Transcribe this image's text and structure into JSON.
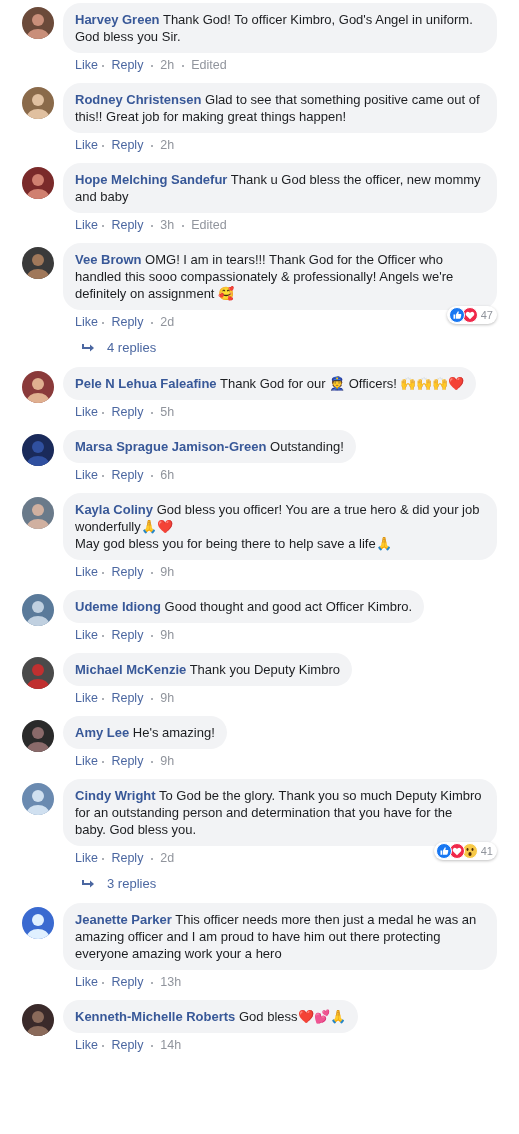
{
  "comments": [
    {
      "author": "Harvey Green",
      "text": "Thank God! To officer Kimbro, God's Angel in uniform. God bless you Sir.",
      "actions": [
        "Like",
        "Reply"
      ],
      "time": "2h",
      "edited": "Edited"
    },
    {
      "author": "Rodney Christensen",
      "text": "Glad to see that something positive came out of this!! Great job for making great things happen!",
      "actions": [
        "Like",
        "Reply"
      ],
      "time": "2h"
    },
    {
      "author": "Hope Melching Sandefur",
      "text": "Thank u God bless the officer, new mommy and baby",
      "actions": [
        "Like",
        "Reply"
      ],
      "time": "3h",
      "edited": "Edited"
    },
    {
      "author": "Vee Brown",
      "text": "OMG! I am in tears!!! Thank God for the Officer who handled this sooo compassionately & professionally! Angels we're definitely on assignment 🥰",
      "actions": [
        "Like",
        "Reply"
      ],
      "time": "2d",
      "reactions": {
        "icons": [
          {
            "kind": "like"
          },
          {
            "kind": "love"
          }
        ],
        "count": "47"
      },
      "replies": "4 replies"
    },
    {
      "author": "Pele N Lehua Faleafine",
      "text": "Thank God for our 👮 Officers! 🙌🙌🙌❤️",
      "actions": [
        "Like",
        "Reply"
      ],
      "time": "5h"
    },
    {
      "author": "Marsa Sprague Jamison-Green",
      "text": "Outstanding!",
      "actions": [
        "Like",
        "Reply"
      ],
      "time": "6h"
    },
    {
      "author": "Kayla Coliny",
      "text": "God bless you officer! You are a true hero & did your job wonderfully🙏❤️\nMay god bless you for being there to help save a life🙏",
      "actions": [
        "Like",
        "Reply"
      ],
      "time": "9h"
    },
    {
      "author": "Udeme Idiong",
      "text": "Good thought and good act Officer Kimbro.",
      "actions": [
        "Like",
        "Reply"
      ],
      "time": "9h"
    },
    {
      "author": "Michael McKenzie",
      "text": "Thank you Deputy Kimbro",
      "actions": [
        "Like",
        "Reply"
      ],
      "time": "9h"
    },
    {
      "author": "Amy Lee",
      "text": "He's amazing!",
      "actions": [
        "Like",
        "Reply"
      ],
      "time": "9h"
    },
    {
      "author": "Cindy Wright",
      "text": "To God be the glory. Thank you so much Deputy Kimbro for an outstanding person and determination that you have for the baby. God bless you.",
      "actions": [
        "Like",
        "Reply"
      ],
      "time": "2d",
      "reactions": {
        "icons": [
          {
            "kind": "like"
          },
          {
            "kind": "love"
          },
          {
            "kind": "wow"
          }
        ],
        "count": "41"
      },
      "replies": "3 replies"
    },
    {
      "author": "Jeanette Parker",
      "text": "This officer needs more then just a medal he was an amazing officer and I am proud to have him out there protecting everyone amazing work your a hero",
      "actions": [
        "Like",
        "Reply"
      ],
      "time": "13h"
    },
    {
      "author": "Kenneth-Michelle Roberts",
      "text": "God bless❤️💕🙏",
      "actions": [
        "Like",
        "Reply"
      ],
      "time": "14h"
    }
  ]
}
